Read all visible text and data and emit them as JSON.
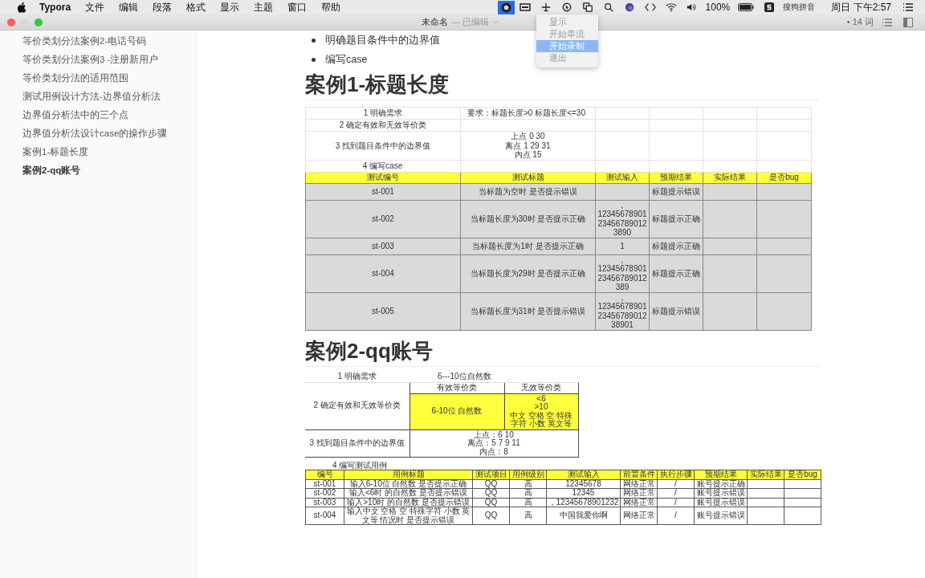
{
  "menu_bar": {
    "app": "Typora",
    "menus": [
      "文件",
      "编辑",
      "段落",
      "格式",
      "显示",
      "主题",
      "窗口",
      "帮助"
    ],
    "battery": "100%",
    "input_method": "搜狗拼音",
    "clock": "周日 下午2:57"
  },
  "window": {
    "title": "未命名",
    "status": "— 已编辑",
    "word_count": "• 14 词"
  },
  "tray_menu": {
    "items": [
      {
        "label": "显示",
        "selected": false
      },
      {
        "label": "开始串流",
        "selected": false
      },
      {
        "label": "开始录制",
        "selected": true
      },
      {
        "label": "退出",
        "selected": false
      }
    ]
  },
  "sidebar": {
    "items": [
      {
        "label": "等价类划分法案例2-电话号码",
        "selected": false
      },
      {
        "label": "等价类划分法案例3 -注册新用户",
        "selected": false
      },
      {
        "label": "等价类划分法的适用范围",
        "selected": false
      },
      {
        "label": "测试用例设计方法-边界值分析法",
        "selected": false
      },
      {
        "label": "边界值分析法中的三个点",
        "selected": false
      },
      {
        "label": "边界值分析法设计case的操作步骤",
        "selected": false
      },
      {
        "label": "案例1-标题长度",
        "selected": false
      },
      {
        "label": "案例2-qq账号",
        "selected": true
      }
    ]
  },
  "content": {
    "bullets": [
      "明确题目条件中的边界值",
      "编写case"
    ],
    "heading_1": "案例1-标题长度",
    "table_1": {
      "steps": [
        {
          "label": "1 明确需求",
          "value": "要求：标题长度>0  标题长度<=30"
        },
        {
          "label": "2 确定有效和无效等价类"
        },
        {
          "label": "3 找到题目条件中的边界值",
          "value": "上点 0 30\n离点  1 29 31\n内点 15"
        },
        {
          "label": "4 编写case"
        }
      ],
      "columns": [
        "测试编号",
        "测试标题",
        "测试输入",
        "预期结果",
        "实际结果",
        "是否bug"
      ],
      "rows": [
        [
          "st-001",
          "当标题为空时 是否提示错误",
          "",
          "标题提示错误"
        ],
        [
          "st-002",
          "当标题长度为30时 是否提示正确",
          ",\n12345678901\n23456789012\n3890",
          "标题提示正确"
        ],
        [
          "st-003",
          "当标题长度为1时 是否提示正确",
          "1",
          "标题提示正确"
        ],
        [
          "st-004",
          "当标题长度为29时 是否提示正确",
          ",\n12345678901\n23456789012\n389",
          "标题提示正确"
        ],
        [
          "st-005",
          "当标题长度为31时 是否提示错误",
          ",\n12345678901\n23456789012\n38901",
          "标题提示错误"
        ]
      ]
    },
    "heading_2": "案例2-qq账号",
    "table_2": {
      "requirement": {
        "label": "1 明确需求",
        "value": "6---10位自然数"
      },
      "classes": {
        "label": "2 确定有效和无效等价类",
        "valid_header": "有效等价类",
        "invalid_header": "无效等价类",
        "valid": "6-10位 自然数",
        "invalid": "<6\n>10\n中文 空格 空 特殊字符 小数 英文等"
      },
      "boundary": {
        "label": "3 找到题目条件中的边界值",
        "value": "上点：6 10\n离点：5 7 9 11\n内点：8"
      },
      "cases_label": "4 编写测试用例",
      "columns": [
        "编号",
        "用例标题",
        "测试项目",
        "用例级别",
        "测试输入",
        "前置条件",
        "执行步骤",
        "预期结果",
        "实际结果",
        "是否bug"
      ],
      "rows": [
        [
          "st-001",
          "输入6-10位 自然数 是否提示正确",
          "QQ",
          "高",
          "12345678",
          "网络正常",
          "/",
          "账号提示正确"
        ],
        [
          "st-002",
          "输入<6时 的自然数 是否提示错误",
          "QQ",
          "高",
          "12345",
          "网络正常",
          "/",
          "账号提示错误"
        ],
        [
          "st-003",
          "输入>10时 的自然数 是否提示错误",
          "QQ",
          "高",
          "，12345678901232",
          "网络正常",
          "/",
          "账号提示错误"
        ],
        [
          "st-004",
          "输入中文 空格 空 特殊字符 小数 英文等 情况时 是否提示错误",
          "QQ",
          "高",
          "中国我爱你啊",
          "网络正常",
          "/",
          "账号提示错误"
        ]
      ]
    }
  }
}
